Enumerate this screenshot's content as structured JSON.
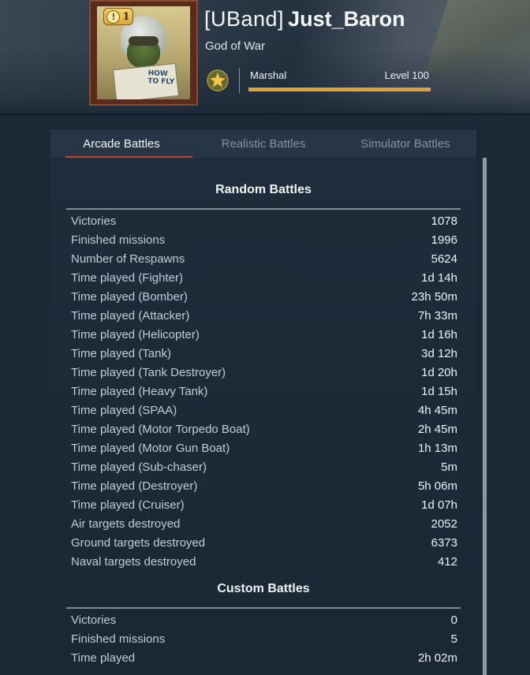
{
  "profile": {
    "clan": "[UBand]",
    "nickname": "Just_Baron",
    "title": "God of War",
    "rank_name": "Marshal",
    "level_text": "Level 100",
    "level_progress": 1.0,
    "notification_count": "1",
    "notification_symbol": "!",
    "avatar_book_text": "HOW TO FLY"
  },
  "tabs": [
    {
      "label": "Arcade Battles",
      "active": true
    },
    {
      "label": "Realistic Battles",
      "active": false
    },
    {
      "label": "Simulator Battles",
      "active": false
    }
  ],
  "random_battles": {
    "title": "Random Battles",
    "rows": [
      {
        "label": "Victories",
        "value": "1078"
      },
      {
        "label": "Finished missions",
        "value": "1996"
      },
      {
        "label": "Number of Respawns",
        "value": "5624"
      },
      {
        "label": "Time played (Fighter)",
        "value": "1d 14h"
      },
      {
        "label": "Time played (Bomber)",
        "value": "23h 50m"
      },
      {
        "label": "Time played (Attacker)",
        "value": "7h 33m"
      },
      {
        "label": "Time played (Helicopter)",
        "value": "1d 16h"
      },
      {
        "label": "Time played (Tank)",
        "value": "3d 12h"
      },
      {
        "label": "Time played (Tank Destroyer)",
        "value": "1d 20h"
      },
      {
        "label": "Time played (Heavy Tank)",
        "value": "1d 15h"
      },
      {
        "label": "Time played (SPAA)",
        "value": "4h 45m"
      },
      {
        "label": "Time played (Motor Torpedo Boat)",
        "value": "2h 45m"
      },
      {
        "label": "Time played (Motor Gun Boat)",
        "value": "1h 13m"
      },
      {
        "label": "Time played (Sub-chaser)",
        "value": "5m"
      },
      {
        "label": "Time played (Destroyer)",
        "value": "5h 06m"
      },
      {
        "label": "Time played (Cruiser)",
        "value": "1d 07h"
      },
      {
        "label": "Air targets destroyed",
        "value": "2052"
      },
      {
        "label": "Ground targets destroyed",
        "value": "6373"
      },
      {
        "label": "Naval targets destroyed",
        "value": "412"
      }
    ]
  },
  "custom_battles": {
    "title": "Custom Battles",
    "rows": [
      {
        "label": "Victories",
        "value": "0"
      },
      {
        "label": "Finished missions",
        "value": "5"
      },
      {
        "label": "Time played",
        "value": "2h 02m"
      }
    ]
  },
  "colors": {
    "accent_tab": "#c9442f",
    "level_bar": "#e0a233",
    "badge_gold": "#f6d36a"
  },
  "icons": {
    "rank": "gold-star-icon",
    "notification": "alert-badge-icon"
  }
}
